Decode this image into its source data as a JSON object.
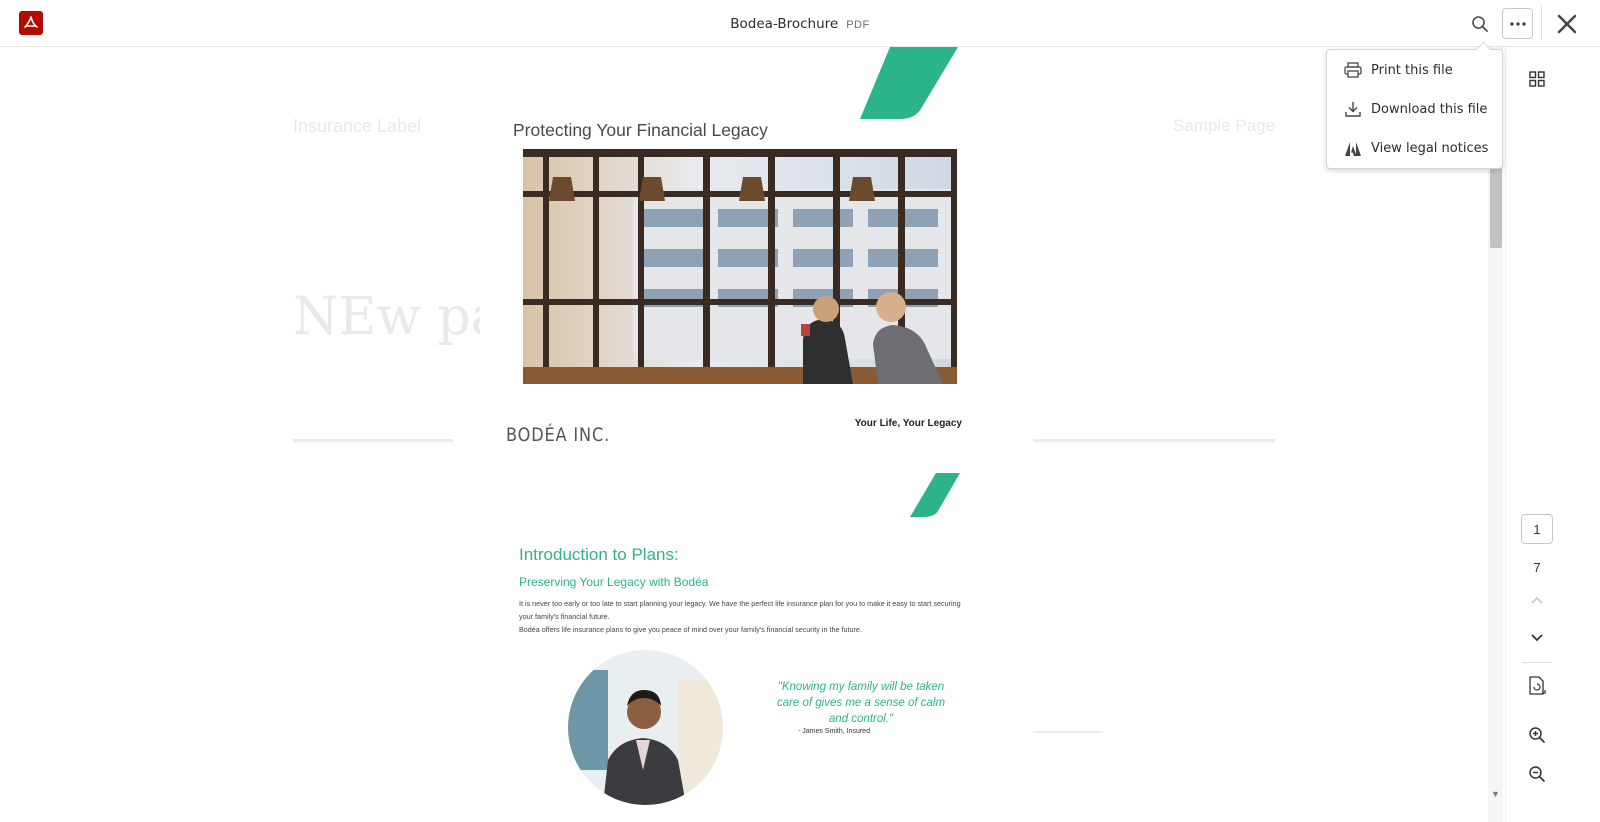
{
  "header": {
    "doc_name": "Bodea-Brochure",
    "doc_type": "PDF"
  },
  "icons": {
    "app": "acrobat-icon",
    "search": "search-icon",
    "more": "more-options-icon",
    "close": "close-icon"
  },
  "menu": {
    "items": [
      {
        "label": "Print this file",
        "icon": "printer-icon"
      },
      {
        "label": "Download this file",
        "icon": "download-icon"
      },
      {
        "label": "View legal notices",
        "icon": "adobe-icon"
      }
    ]
  },
  "background_page": {
    "header_left": "Insurance Label",
    "header_right": "Sample Page",
    "title_fragment": "NEw pa"
  },
  "page": {
    "heading": "Protecting Your Financial Legacy",
    "logo": "BODÉA INC.",
    "tagline": "Your Life, Your Legacy",
    "intro_title": "Introduction to Plans:",
    "intro_subtitle": "Preserving Your Legacy with Bodéa",
    "paragraph1": "It is never too early or too late to start planning your legacy. We have the perfect life insurance plan for you to make it easy to start securing your family's financial future.",
    "paragraph2": "Bodéa offers life insurance plans to give you peace of mind over your family's financial security in the future.",
    "quote": "\"Knowing my family will be taken care of gives me a sense of calm and control.\"",
    "attribution": "-        James Smith, Insured"
  },
  "navigation": {
    "current_page": "1",
    "total_pages": "7"
  },
  "colors": {
    "accent_green": "#2db38a",
    "acrobat_red": "#b30b00"
  }
}
